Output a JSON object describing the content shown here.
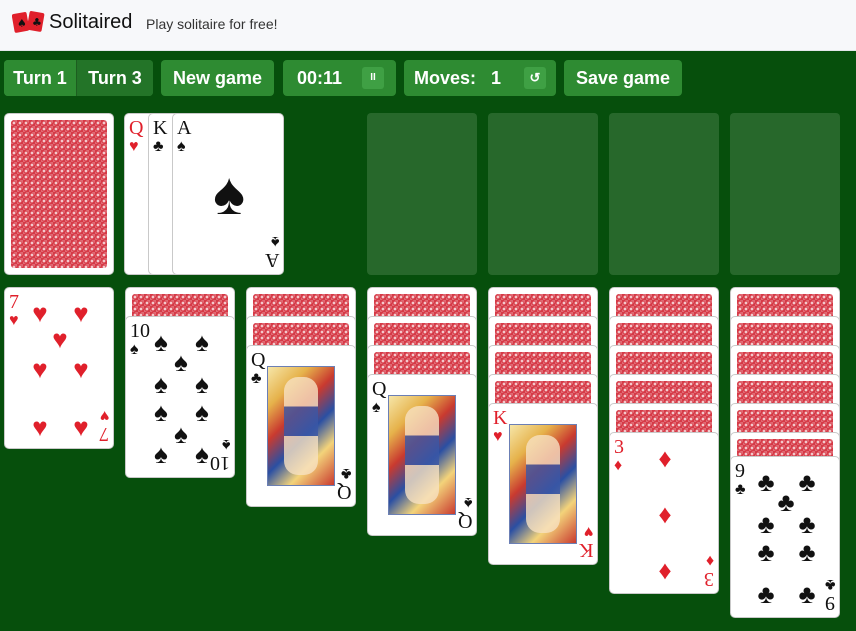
{
  "header": {
    "brand": "Solitaired",
    "tagline": "Play solitaire for free!"
  },
  "toolbar": {
    "turn1_label": "Turn 1",
    "turn3_label": "Turn 3",
    "new_game_label": "New game",
    "timer": "00:11",
    "moves_label": "Moves:",
    "moves_count": "1",
    "save_label": "Save game",
    "pause_icon": "II",
    "undo_icon": "↺"
  },
  "colors": {
    "table": "#064f0c",
    "button": "#2e8b32",
    "card_back": "#d63a47",
    "red_suit": "#e0202b"
  },
  "cards": {
    "waste_q": "Q",
    "waste_k": "K",
    "waste_a": "A",
    "t1_rank": "7",
    "t2_rank": "10",
    "t3_rank": "Q",
    "t4_rank": "Q",
    "t5_rank": "K",
    "t6_rank": "3",
    "t7_rank": "9",
    "hearts": "♥",
    "spades": "♠",
    "clubs": "♣",
    "diamonds": "♦"
  }
}
